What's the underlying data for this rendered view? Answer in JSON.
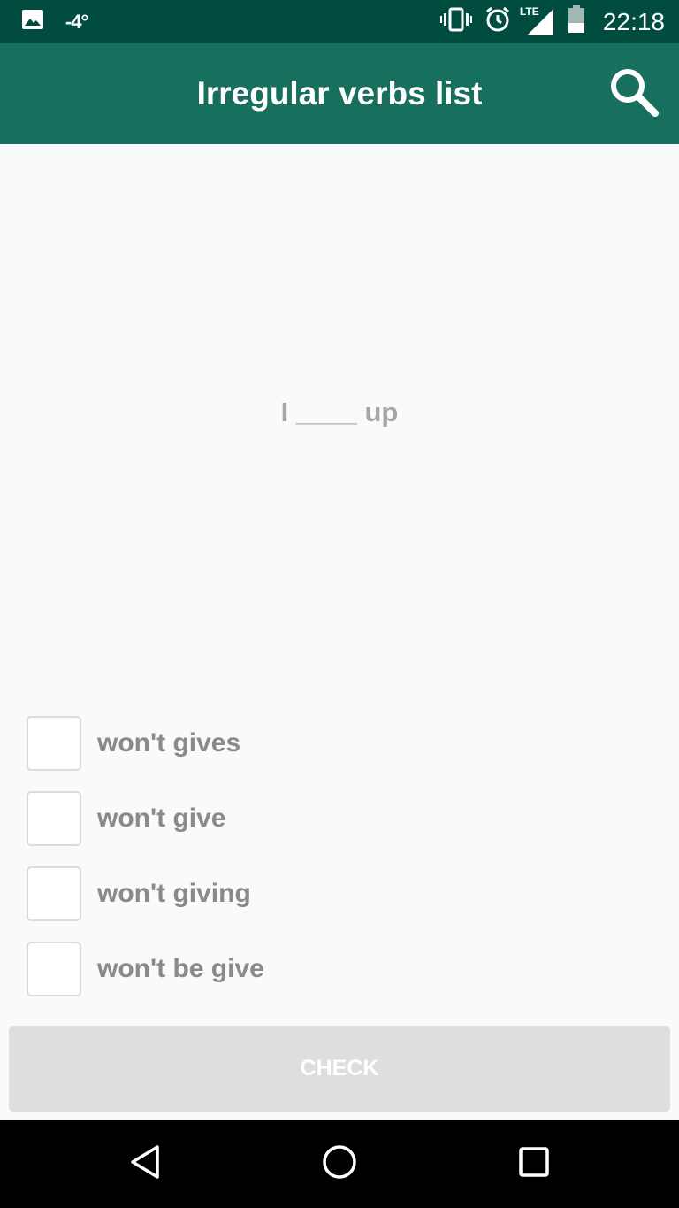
{
  "status_bar": {
    "temperature": "-4°",
    "network": "LTE",
    "time": "22:18",
    "icons": [
      "image-icon",
      "vibrate-icon",
      "alarm-icon",
      "signal-icon",
      "battery-icon"
    ]
  },
  "app_bar": {
    "title": "Irregular verbs list",
    "search_icon": "search-icon"
  },
  "quiz": {
    "question": "I ____ up",
    "options": [
      {
        "label": "won't gives",
        "checked": false
      },
      {
        "label": "won't give",
        "checked": false
      },
      {
        "label": "won't giving",
        "checked": false
      },
      {
        "label": "won't be give",
        "checked": false
      }
    ],
    "check_label": "CHECK"
  },
  "nav_bar": {
    "icons": [
      "back-icon",
      "home-icon",
      "recents-icon"
    ]
  },
  "colors": {
    "status_bar": "#004d40",
    "app_bar": "#176f5e",
    "button_disabled": "#dedede",
    "question_text": "#a6a6a6",
    "option_text": "#8a8a8a"
  }
}
